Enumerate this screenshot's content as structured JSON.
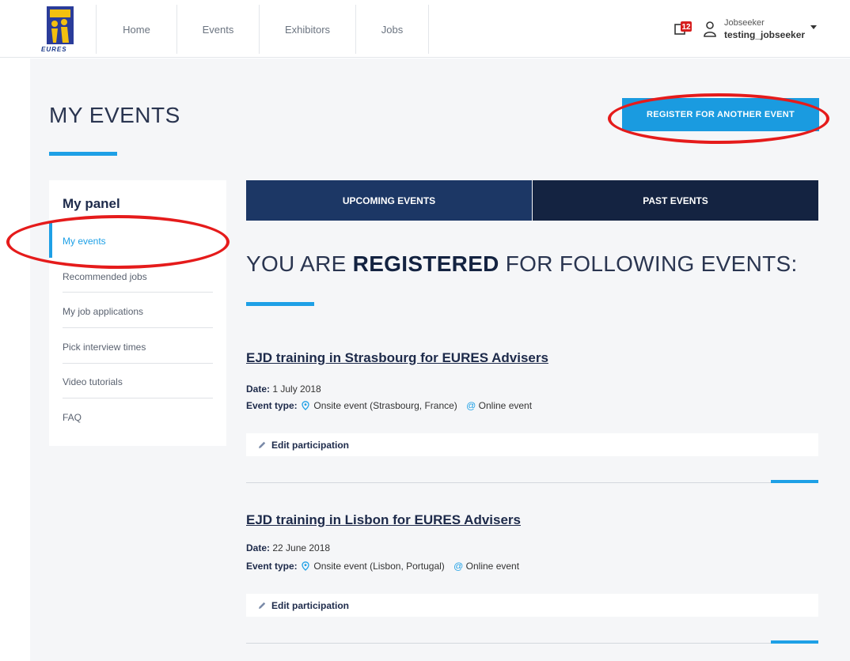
{
  "header": {
    "logo_text": "EURES",
    "nav": [
      {
        "label": "Home"
      },
      {
        "label": "Events"
      },
      {
        "label": "Exhibitors"
      },
      {
        "label": "Jobs"
      }
    ],
    "notifications_count": "12",
    "user": {
      "role": "Jobseeker",
      "name": "testing_jobseeker"
    }
  },
  "page": {
    "title": "MY EVENTS",
    "register_button": "REGISTER FOR ANOTHER EVENT"
  },
  "panel": {
    "title": "My panel",
    "items": [
      {
        "label": "My events",
        "active": true
      },
      {
        "label": "Recommended jobs"
      },
      {
        "label": "My job applications"
      },
      {
        "label": "Pick interview times"
      },
      {
        "label": "Video tutorials"
      },
      {
        "label": "FAQ"
      }
    ]
  },
  "tabs": [
    {
      "label": "UPCOMING EVENTS"
    },
    {
      "label": "PAST EVENTS"
    }
  ],
  "registered_heading": {
    "pre": "YOU ARE ",
    "bold": "REGISTERED",
    "post": " FOR FOLLOWING EVENTS:"
  },
  "events": [
    {
      "title": "EJD training in Strasbourg for EURES Advisers",
      "date_label": "Date:",
      "date": " 1 July 2018",
      "type_label": "Event type:",
      "onsite": "Onsite event (Strasbourg, France)",
      "online": "Online event",
      "edit": "Edit participation"
    },
    {
      "title": "EJD training in Lisbon for EURES Advisers",
      "date_label": "Date:",
      "date": " 22 June 2018",
      "type_label": "Event type:",
      "onsite": "Onsite event (Lisbon, Portugal)",
      "online": "Online event",
      "edit": "Edit participation"
    }
  ],
  "colors": {
    "accent": "#1ea0e6",
    "tab_active": "#1c3765",
    "tab_inactive": "#142341",
    "annotation": "#e51b1b"
  }
}
